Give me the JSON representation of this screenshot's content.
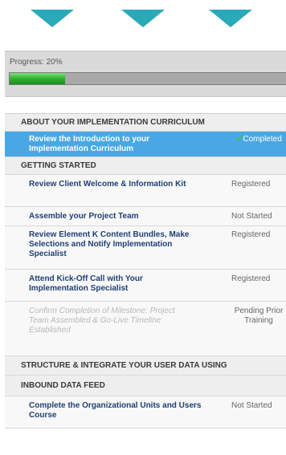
{
  "progress": {
    "label": "Progress:",
    "value": "20%",
    "fraction": 0.2
  },
  "curriculum": {
    "sections": [
      {
        "title": "ABOUT YOUR IMPLEMENTATION CURRICULUM",
        "items": [
          {
            "title": "Review the Introduction to your Implementation Curriculum",
            "status": "Completed",
            "state": "highlight",
            "status_icon": "checkmark-icon"
          }
        ]
      },
      {
        "title": "GETTING STARTED",
        "items": [
          {
            "title": "Review Client Welcome & Information Kit",
            "status": "Registered",
            "state": "normal"
          },
          {
            "title": "Assemble your Project Team",
            "status": "Not Started",
            "state": "normal"
          },
          {
            "title": "Review Element K Content Bundles, Make Selections and Notify Implementation Specialist",
            "status": "Registered",
            "state": "normal"
          },
          {
            "title": "Attend Kick-Off Call with Your Implementation Specialist",
            "status": "Registered",
            "state": "normal"
          },
          {
            "title": "Confirm Completion of Milestone: Project Team Assembled & Go-Live Timeline Established",
            "status": "Pending Prior Training",
            "state": "disabled"
          }
        ]
      },
      {
        "title": "STRUCTURE & INTEGRATE YOUR USER DATA USING",
        "items": []
      },
      {
        "title": "INBOUND DATA FEED",
        "items": [
          {
            "title": "Complete the Organizational Units and Users Course",
            "status": "Not Started",
            "state": "normal"
          }
        ]
      }
    ]
  },
  "colors": {
    "arrow": "#2aa9b8",
    "highlight": "#49a8e4",
    "progress_fill": "#2fb12f",
    "link": "#1f3f73"
  }
}
